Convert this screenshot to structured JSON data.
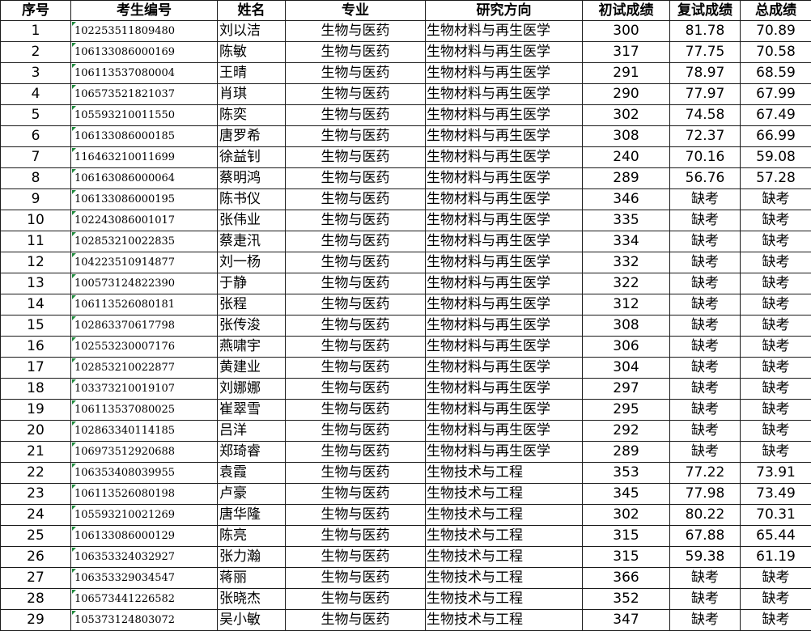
{
  "headers": [
    "序号",
    "考生编号",
    "姓名",
    "专业",
    "研究方向",
    "初试成绩",
    "复试成绩",
    "总成绩"
  ],
  "rows": [
    [
      "1",
      "102253511809480",
      "刘以洁",
      "生物与医药",
      "生物材料与再生医学",
      "300",
      "81.78",
      "70.89"
    ],
    [
      "2",
      "106133086000169",
      "陈敏",
      "生物与医药",
      "生物材料与再生医学",
      "317",
      "77.75",
      "70.58"
    ],
    [
      "3",
      "106113537080004",
      "王晴",
      "生物与医药",
      "生物材料与再生医学",
      "291",
      "78.97",
      "68.59"
    ],
    [
      "4",
      "106573521821037",
      "肖琪",
      "生物与医药",
      "生物材料与再生医学",
      "290",
      "77.97",
      "67.99"
    ],
    [
      "5",
      "105593210011550",
      "陈奕",
      "生物与医药",
      "生物材料与再生医学",
      "302",
      "74.58",
      "67.49"
    ],
    [
      "6",
      "106133086000185",
      "唐罗希",
      "生物与医药",
      "生物材料与再生医学",
      "308",
      "72.37",
      "66.99"
    ],
    [
      "7",
      "116463210011699",
      "徐益钊",
      "生物与医药",
      "生物材料与再生医学",
      "240",
      "70.16",
      "59.08"
    ],
    [
      "8",
      "106163086000064",
      "蔡明鸿",
      "生物与医药",
      "生物材料与再生医学",
      "289",
      "56.76",
      "57.28"
    ],
    [
      "9",
      "106133086000195",
      "陈书仪",
      "生物与医药",
      "生物材料与再生医学",
      "346",
      "缺考",
      "缺考"
    ],
    [
      "10",
      "102243086001017",
      "张伟业",
      "生物与医药",
      "生物材料与再生医学",
      "335",
      "缺考",
      "缺考"
    ],
    [
      "11",
      "102853210022835",
      "蔡疌汛",
      "生物与医药",
      "生物材料与再生医学",
      "334",
      "缺考",
      "缺考"
    ],
    [
      "12",
      "104223510914877",
      "刘一杨",
      "生物与医药",
      "生物材料与再生医学",
      "332",
      "缺考",
      "缺考"
    ],
    [
      "13",
      "100573124822390",
      "于静",
      "生物与医药",
      "生物材料与再生医学",
      "322",
      "缺考",
      "缺考"
    ],
    [
      "14",
      "106113526080181",
      "张程",
      "生物与医药",
      "生物材料与再生医学",
      "312",
      "缺考",
      "缺考"
    ],
    [
      "15",
      "102863370617798",
      "张传浚",
      "生物与医药",
      "生物材料与再生医学",
      "308",
      "缺考",
      "缺考"
    ],
    [
      "16",
      "102553230007176",
      "燕啸宇",
      "生物与医药",
      "生物材料与再生医学",
      "306",
      "缺考",
      "缺考"
    ],
    [
      "17",
      "102853210022877",
      "黄建业",
      "生物与医药",
      "生物材料与再生医学",
      "304",
      "缺考",
      "缺考"
    ],
    [
      "18",
      "103373210019107",
      "刘娜娜",
      "生物与医药",
      "生物材料与再生医学",
      "297",
      "缺考",
      "缺考"
    ],
    [
      "19",
      "106113537080025",
      "崔翠雪",
      "生物与医药",
      "生物材料与再生医学",
      "295",
      "缺考",
      "缺考"
    ],
    [
      "20",
      "102863340114185",
      "吕洋",
      "生物与医药",
      "生物材料与再生医学",
      "292",
      "缺考",
      "缺考"
    ],
    [
      "21",
      "106973512920688",
      "郑琦睿",
      "生物与医药",
      "生物材料与再生医学",
      "289",
      "缺考",
      "缺考"
    ],
    [
      "22",
      "106353408039955",
      "袁霞",
      "生物与医药",
      "生物技术与工程",
      "353",
      "77.22",
      "73.91"
    ],
    [
      "23",
      "106113526080198",
      "卢豪",
      "生物与医药",
      "生物技术与工程",
      "345",
      "77.98",
      "73.49"
    ],
    [
      "24",
      "105593210021269",
      "唐华隆",
      "生物与医药",
      "生物技术与工程",
      "302",
      "80.22",
      "70.31"
    ],
    [
      "25",
      "106133086000129",
      "陈亮",
      "生物与医药",
      "生物技术与工程",
      "315",
      "67.88",
      "65.44"
    ],
    [
      "26",
      "106353324032927",
      "张力瀚",
      "生物与医药",
      "生物技术与工程",
      "315",
      "59.38",
      "61.19"
    ],
    [
      "27",
      "106353329034547",
      "蒋丽",
      "生物与医药",
      "生物技术与工程",
      "366",
      "缺考",
      "缺考"
    ],
    [
      "28",
      "106573441226582",
      "张晓杰",
      "生物与医药",
      "生物技术与工程",
      "352",
      "缺考",
      "缺考"
    ],
    [
      "29",
      "105373124803072",
      "吴小敏",
      "生物与医药",
      "生物技术与工程",
      "347",
      "缺考",
      "缺考"
    ]
  ]
}
